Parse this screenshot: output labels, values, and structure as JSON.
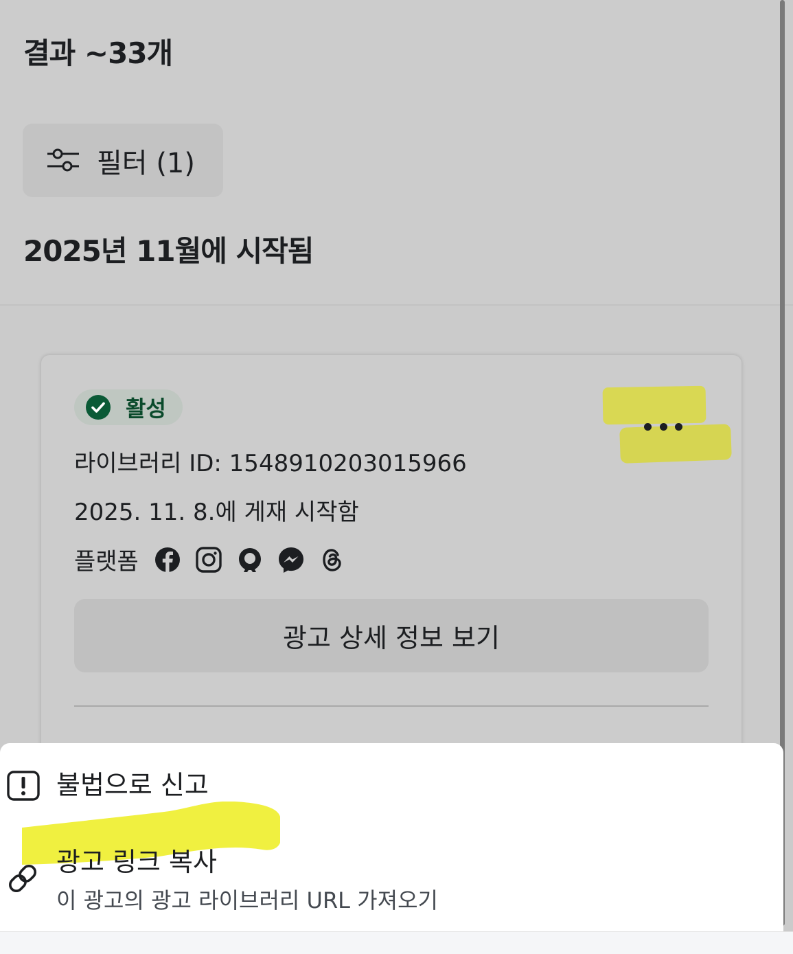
{
  "header": {
    "results_title": "결과 ~33개",
    "filter_label": "필터 (1)",
    "section_heading": "2025년 11월에 시작됨"
  },
  "card": {
    "status_badge": "활성",
    "library_id": "라이브러리 ID: 1548910203015966",
    "start_date": "2025. 11. 8.에 게재 시작함",
    "platforms_label": "플랫폼",
    "platform_icons": [
      "facebook-icon",
      "instagram-icon",
      "audience-network-icon",
      "messenger-icon",
      "threads-icon"
    ],
    "details_button": "광고 상세 정보 보기"
  },
  "menu": {
    "report_label": "불법으로 신고",
    "copy_label": "광고 링크 복사",
    "copy_sub": "이 광고의 광고 라이브러리 URL 가져오기"
  },
  "colors": {
    "badge_text": "#0a4a2b",
    "highlight": "#f0f040"
  }
}
